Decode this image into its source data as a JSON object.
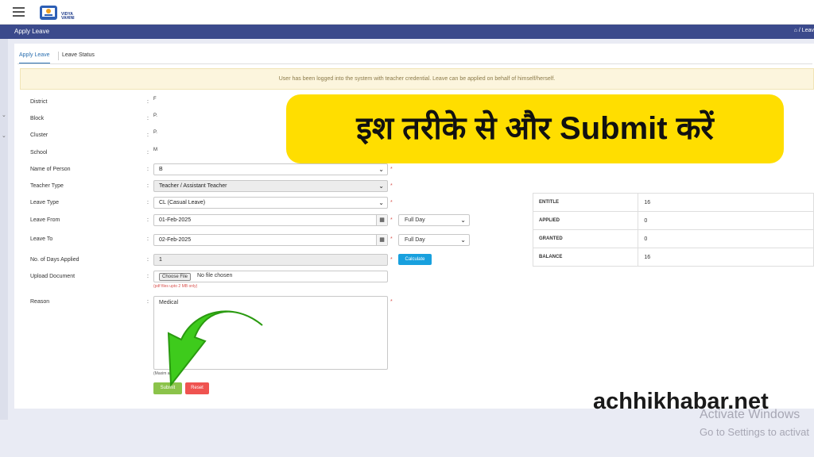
{
  "header": {
    "logo_text_line1": "VIDYA",
    "logo_text_line2": "VAHINI"
  },
  "titlebar": {
    "title": "Apply Leave",
    "breadcrumb": "/ Leav"
  },
  "tabs": [
    {
      "label": "Apply Leave",
      "active": true
    },
    {
      "label": "Leave Status",
      "active": false
    }
  ],
  "notice": "User has been logged into the system with teacher credential. Leave can be applied on behalf of himself/herself.",
  "form": {
    "district": {
      "label": "District",
      "value": "F"
    },
    "block": {
      "label": "Block",
      "value": "P."
    },
    "cluster": {
      "label": "Cluster",
      "value": "P."
    },
    "school": {
      "label": "School",
      "value": "M"
    },
    "name_of_person": {
      "label": "Name of Person",
      "value": "B"
    },
    "teacher_type": {
      "label": "Teacher Type",
      "value": "Teacher / Assistant Teacher"
    },
    "leave_type": {
      "label": "Leave Type",
      "value": "CL (Casual Leave)"
    },
    "leave_from": {
      "label": "Leave From",
      "value": "01-Feb-2025",
      "day_type": "Full Day"
    },
    "leave_to": {
      "label": "Leave To",
      "value": "02-Feb-2025",
      "day_type": "Full Day"
    },
    "days_applied": {
      "label": "No. of Days Applied",
      "value": "1"
    },
    "calculate_label": "Calculate",
    "upload": {
      "label": "Upload Document",
      "button": "Choose File",
      "status": "No file chosen",
      "hint": "(pdf files upto 2 MB only)"
    },
    "reason": {
      "label": "Reason",
      "value": "Medical",
      "max_note": "(Maxim                    acters)"
    },
    "colon": ":",
    "required_mark": "*",
    "submit_label": "Submit",
    "reset_label": "Reset"
  },
  "balance": [
    {
      "key": "ENTITLE",
      "value": "16"
    },
    {
      "key": "APPLIED",
      "value": "0"
    },
    {
      "key": "GRANTED",
      "value": "0"
    },
    {
      "key": "BALANCE",
      "value": "16"
    }
  ],
  "overlay": {
    "banner_text": "इश तरीके से और Submit करें",
    "watermark": "achhikhabar.net",
    "activate_line1": "Activate Windows",
    "activate_line2": "Go to Settings to activat"
  },
  "colors": {
    "titlebar": "#3b4a8c",
    "banner": "#ffde00",
    "arrow": "#3ecb1c",
    "submit": "#8bc34a",
    "reset": "#ef5350",
    "calculate": "#18a0de"
  }
}
